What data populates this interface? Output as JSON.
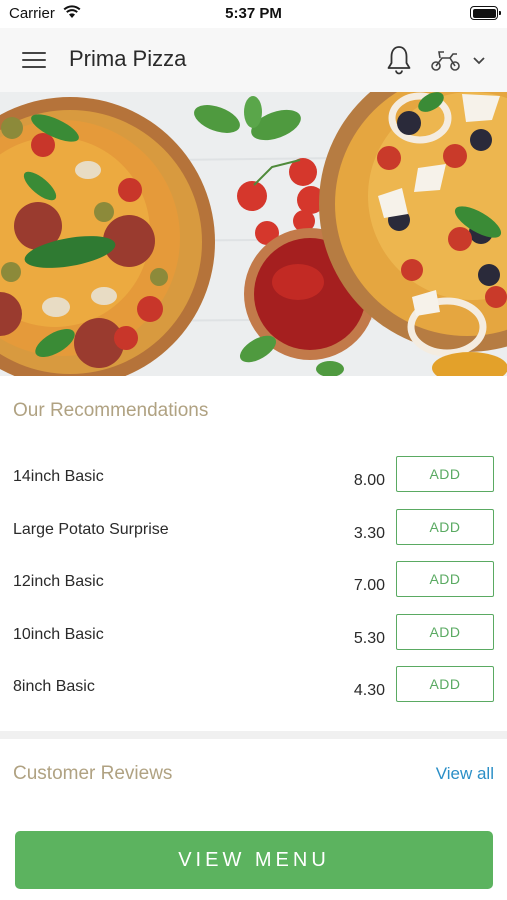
{
  "status_bar": {
    "carrier": "Carrier",
    "time": "5:37 PM"
  },
  "header": {
    "title": "Prima Pizza",
    "icons": [
      "menu-icon",
      "bell-icon",
      "scooter-icon",
      "chevron-down-icon"
    ]
  },
  "hero": {
    "image": "pizza-banner"
  },
  "recommendations": {
    "title": "Our Recommendations",
    "items": [
      {
        "name": "14inch Basic",
        "price": "8.00",
        "button": "ADD"
      },
      {
        "name": "Large Potato Surprise",
        "price": "3.30",
        "button": "ADD"
      },
      {
        "name": "12inch Basic",
        "price": "7.00",
        "button": "ADD"
      },
      {
        "name": "10inch Basic",
        "price": "5.30",
        "button": "ADD"
      },
      {
        "name": "8inch Basic",
        "price": "4.30",
        "button": "ADD"
      }
    ]
  },
  "reviews": {
    "title": "Customer Reviews",
    "view_all": "View all"
  },
  "footer": {
    "button": "VIEW MENU"
  },
  "colors": {
    "accent": "#5cb35f",
    "section_title": "#b0a282",
    "link": "#2b8fc7"
  }
}
